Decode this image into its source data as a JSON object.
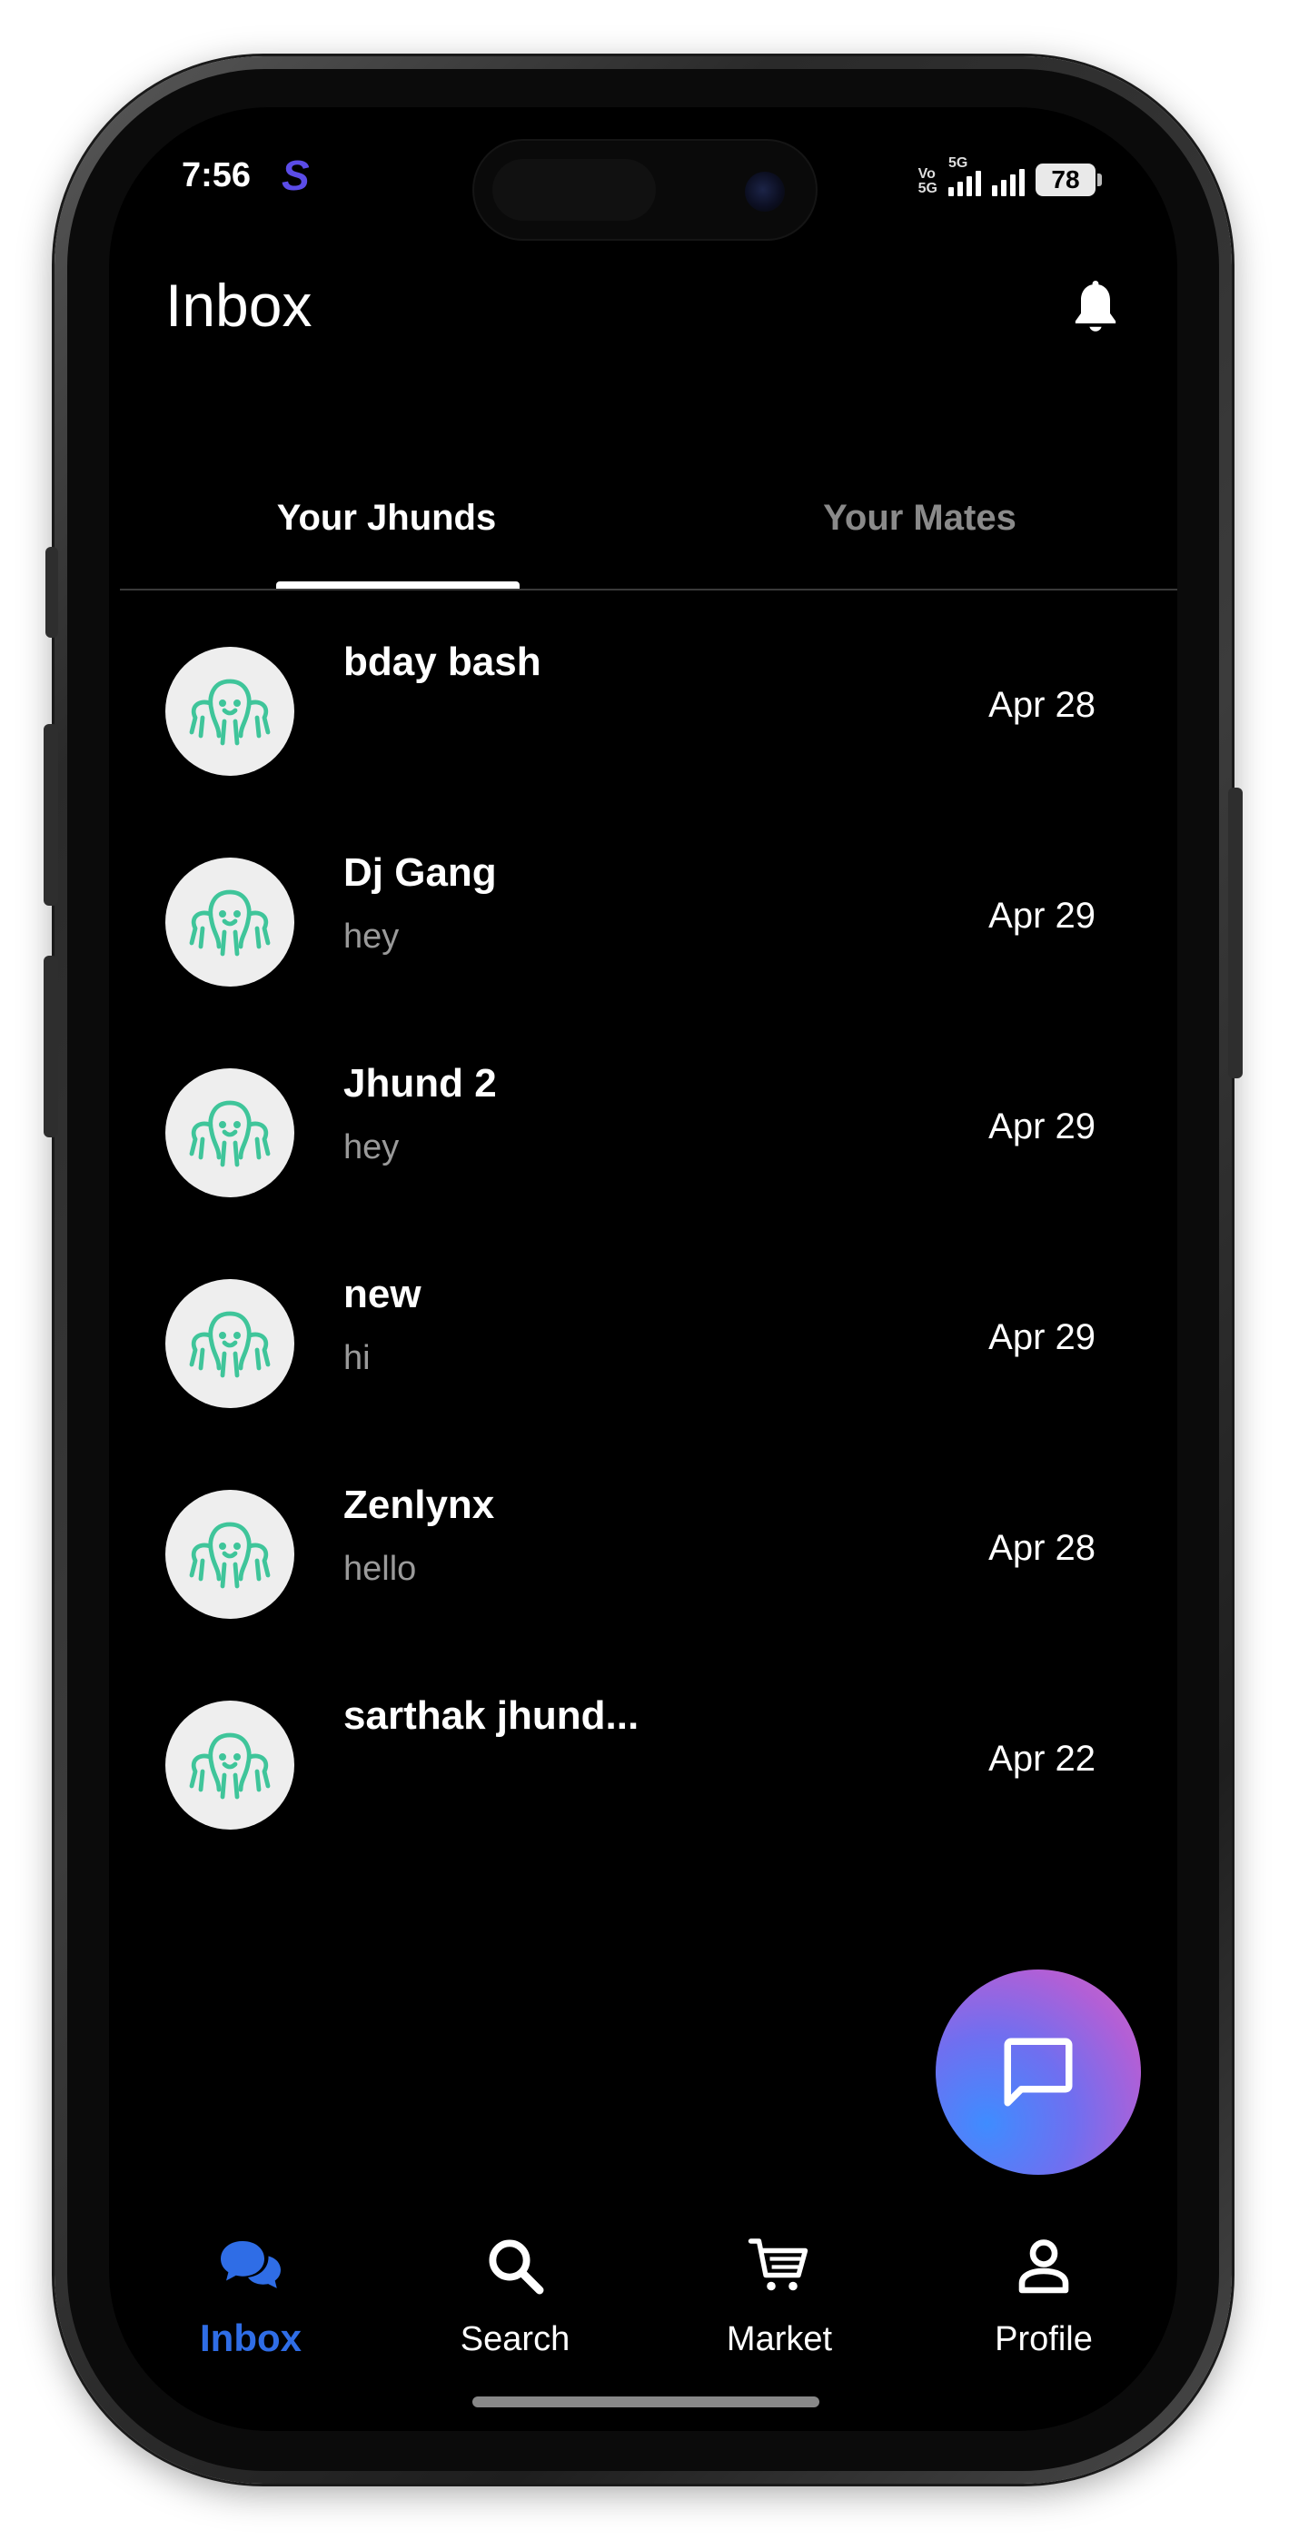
{
  "status_bar": {
    "time": "7:56",
    "app_badge": "S",
    "network_1": "Vo",
    "network_2": "5G",
    "network_3": "5G",
    "battery": "78"
  },
  "header": {
    "title": "Inbox",
    "notifications_icon": "bell-icon"
  },
  "tabs": [
    {
      "label": "Your Jhunds",
      "active": true
    },
    {
      "label": "Your Mates",
      "active": false
    }
  ],
  "chats": [
    {
      "name": "bday bash",
      "preview": "",
      "date": "Apr 28"
    },
    {
      "name": "Dj Gang",
      "preview": "hey",
      "date": "Apr 29"
    },
    {
      "name": "Jhund 2",
      "preview": "hey",
      "date": "Apr 29"
    },
    {
      "name": "new",
      "preview": "hi",
      "date": "Apr 29"
    },
    {
      "name": "Zenlynx",
      "preview": "hello",
      "date": "Apr 28"
    },
    {
      "name": "sarthak jhund...",
      "preview": "",
      "date": "Apr 22"
    }
  ],
  "fab": {
    "icon": "chat-bubble-icon"
  },
  "bottom_nav": [
    {
      "label": "Inbox",
      "icon": "chat-bubbles-icon",
      "active": true
    },
    {
      "label": "Search",
      "icon": "search-icon",
      "active": false
    },
    {
      "label": "Market",
      "icon": "cart-icon",
      "active": false
    },
    {
      "label": "Profile",
      "icon": "person-icon",
      "active": false
    }
  ],
  "colors": {
    "background": "#000000",
    "accent": "#2f6de6",
    "avatar_bg": "#eeeeee",
    "avatar_icon": "#3fc59a",
    "muted_text": "#9a9a9a"
  }
}
